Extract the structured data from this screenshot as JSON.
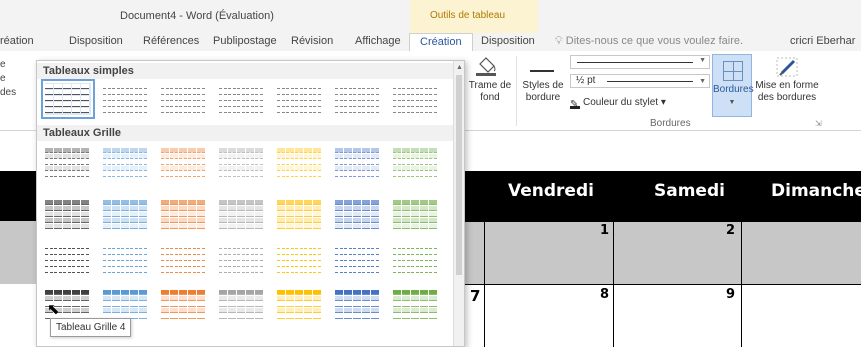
{
  "window": {
    "title": "Document4 - Word (Évaluation)",
    "tools_context": "Outils de tableau",
    "user": "cricri Eberhar"
  },
  "tabs": [
    {
      "label": "réation"
    },
    {
      "label": "Disposition"
    },
    {
      "label": "Références"
    },
    {
      "label": "Publipostage"
    },
    {
      "label": "Révision"
    },
    {
      "label": "Affichage"
    },
    {
      "label": "Création",
      "active": true
    },
    {
      "label": "Disposition"
    }
  ],
  "tell_me": {
    "placeholder": "Dites-nous ce que vous voulez faire."
  },
  "ribbon": {
    "left_fragments": [
      "e",
      "e",
      "des"
    ],
    "trame": "Trame de fond",
    "styles_bordure": "Styles de bordure",
    "pen_weight": "½ pt",
    "pen_color": "Couleur du stylet",
    "bordures": "Bordures",
    "mise_en_forme": "Mise en forme des bordures",
    "group_label": "Bordures"
  },
  "gallery": {
    "section1": "Tableaux simples",
    "section2": "Tableaux Grille",
    "tooltip": "Tableau Grille 4",
    "colors": {
      "black": "#404040",
      "blue": "#5b9bd5",
      "orange": "#ed7d31",
      "gray": "#a5a5a5",
      "gold": "#ffc000",
      "navy": "#4472c4",
      "green": "#70ad47"
    }
  },
  "calendar": {
    "days": [
      "Vendredi",
      "Samedi",
      "Dimanche"
    ],
    "numbers": [
      "1",
      "2",
      "7",
      "8",
      "9"
    ]
  }
}
